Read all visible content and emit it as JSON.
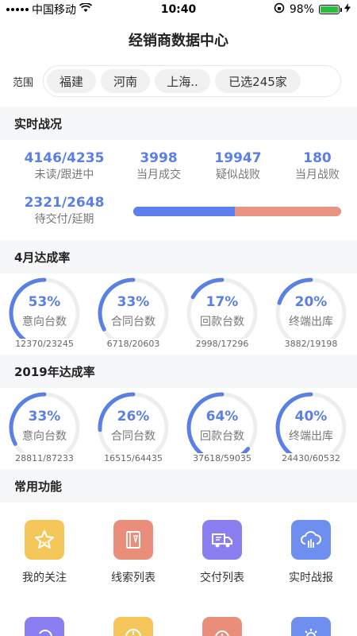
{
  "status_bar": {
    "carrier": "中国移动",
    "time": "10:40",
    "battery": "98%",
    "battery_level": 0.98
  },
  "header": {
    "title": "经销商数据中心"
  },
  "scope": {
    "label": "范围",
    "chips": [
      "福建",
      "河南",
      "上海..",
      "已选245家"
    ]
  },
  "realtime": {
    "title": "实时战况",
    "stats": [
      {
        "value": "4146/4235",
        "label": "未读/跟进中"
      },
      {
        "value": "3998",
        "label": "当月成交"
      },
      {
        "value": "19947",
        "label": "疑似战败"
      },
      {
        "value": "180",
        "label": "当月战败"
      },
      {
        "value": "2321/2648",
        "label": "待交付/延期"
      }
    ],
    "progress_ratio": 0.49
  },
  "april": {
    "title": "4月达成率",
    "rings": [
      {
        "percent": "53%",
        "label": "意向台数",
        "ratio": "12370/23245",
        "fraction": 0.53
      },
      {
        "percent": "33%",
        "label": "合同台数",
        "ratio": "6718/20603",
        "fraction": 0.33
      },
      {
        "percent": "17%",
        "label": "回款台数",
        "ratio": "2998/17296",
        "fraction": 0.17
      },
      {
        "percent": "20%",
        "label": "终端出库",
        "ratio": "3882/19198",
        "fraction": 0.2
      }
    ]
  },
  "year2019": {
    "title": "2019年达成率",
    "rings": [
      {
        "percent": "33%",
        "label": "意向台数",
        "ratio": "28811/87233",
        "fraction": 0.33
      },
      {
        "percent": "26%",
        "label": "合同台数",
        "ratio": "16515/64435",
        "fraction": 0.26
      },
      {
        "percent": "64%",
        "label": "回款台数",
        "ratio": "37618/59035",
        "fraction": 0.64
      },
      {
        "percent": "40%",
        "label": "终端出库",
        "ratio": "24430/60532",
        "fraction": 0.4
      }
    ]
  },
  "functions": {
    "title": "常用功能",
    "items": [
      {
        "label": "我的关注",
        "icon": "star-icon",
        "color": "#f5c65a"
      },
      {
        "label": "线索列表",
        "icon": "notebook-icon",
        "color": "#e98e7b"
      },
      {
        "label": "交付列表",
        "icon": "truck-icon",
        "color": "#8b7ef0"
      },
      {
        "label": "实时战报",
        "icon": "cloud-report-icon",
        "color": "#6f8ff0"
      }
    ],
    "second_row_colors": [
      "#8b7ef0",
      "#f5c65a",
      "#e98e7b",
      "#6f8ff0"
    ]
  },
  "colors": {
    "accent": "#5a7fe6",
    "ring_track": "#eeeeee",
    "progress_red": "#e99383"
  }
}
